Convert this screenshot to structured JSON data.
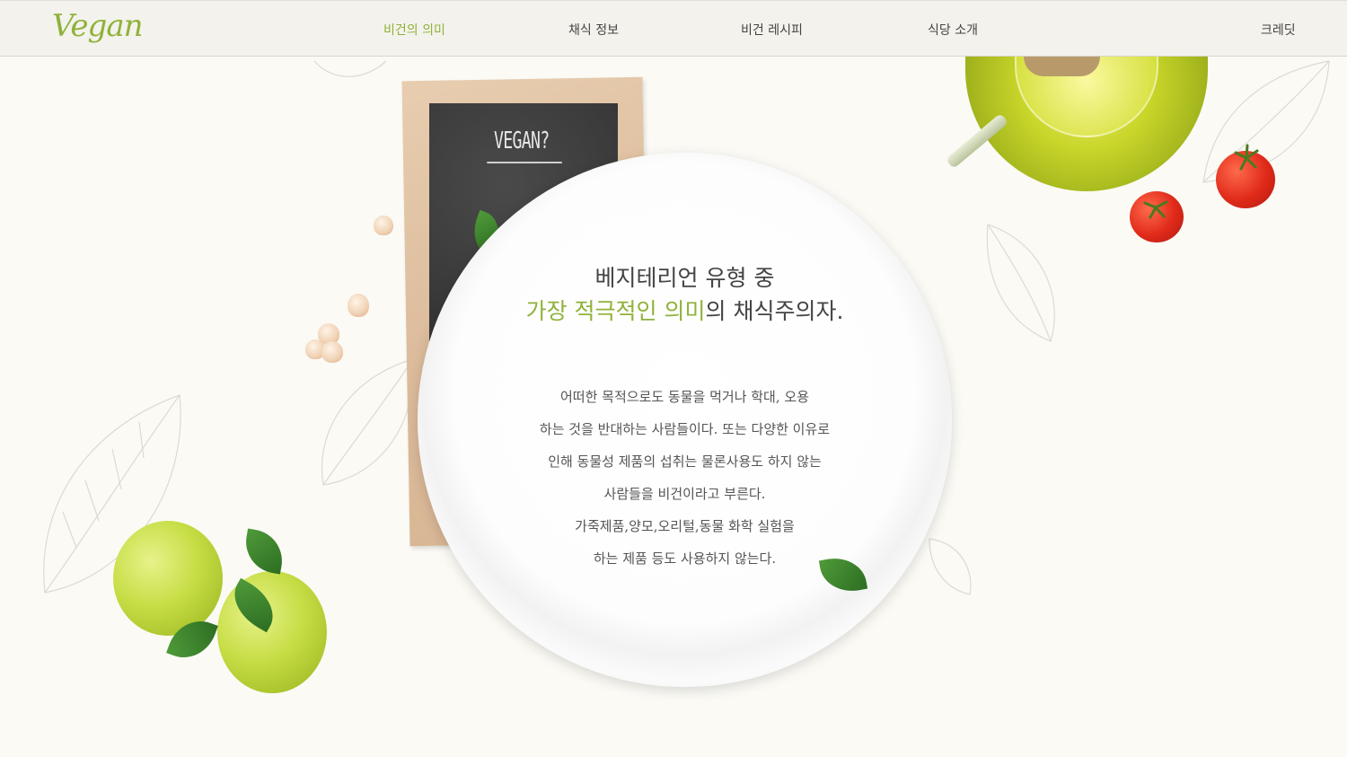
{
  "header": {
    "logo": "Vegan",
    "nav": [
      "비건의 의미",
      "채식 정보",
      "비건 레시피",
      "식당 소개"
    ],
    "active_index": 0,
    "credit": "크레딧"
  },
  "decor": {
    "board_text": "VEGAN?"
  },
  "main": {
    "heading_line1": "베지테리언 유형 중",
    "heading_line2_accent": "가장 적극적인 의미",
    "heading_line2_rest": "의 채식주의자.",
    "paragraph": [
      "어떠한 목적으로도 동물을 먹거나 학대, 오용",
      "하는 것을 반대하는 사람들이다. 또는 다양한 이유로",
      "인해 동물성 제품의 섭취는 물론사용도 하지 않는",
      "사람들을 비건이라고 부른다.",
      "가죽제품,양모,오리털,동물 화학 실험을",
      "하는 제품 등도 사용하지 않는다."
    ]
  },
  "colors": {
    "accent": "#8fb23a",
    "header_bg": "#f4f2ec",
    "page_bg": "#fbfaf5"
  }
}
